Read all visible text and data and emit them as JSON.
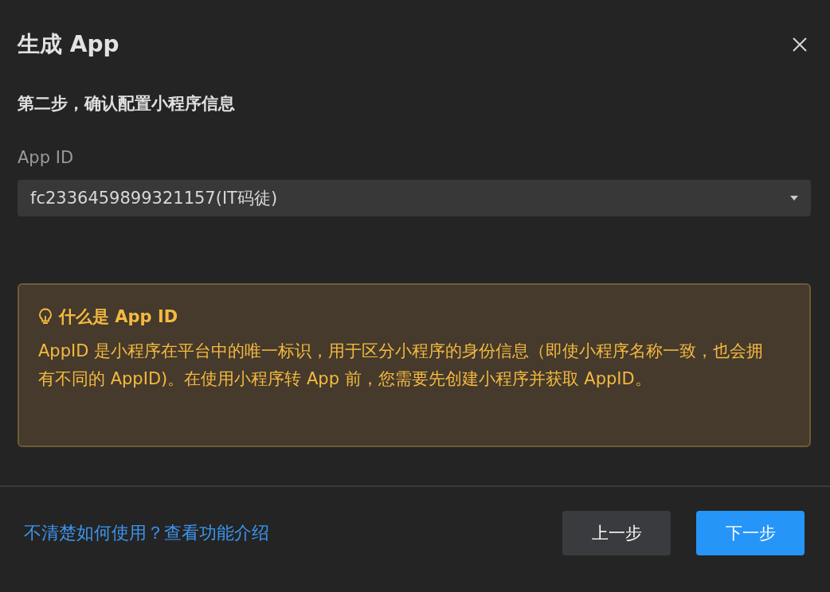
{
  "dialog": {
    "title": "生成 App"
  },
  "step_heading": "第二步，确认配置小程序信息",
  "app_id_field": {
    "label": "App ID",
    "value": "fc2336459899321157(IT码徒)"
  },
  "notice": {
    "title": "什么是 App ID",
    "body": "AppID 是小程序在平台中的唯一标识，用于区分小程序的身份信息（即使小程序名称一致，也会拥有不同的 AppID)。在使用小程序转 App 前，您需要先创建小程序并获取 AppID。"
  },
  "help_link": "不清楚如何使用？查看功能介绍",
  "buttons": [
    {
      "label": "上一步",
      "kind": "secondary"
    },
    {
      "label": "下一步",
      "kind": "primary"
    }
  ]
}
